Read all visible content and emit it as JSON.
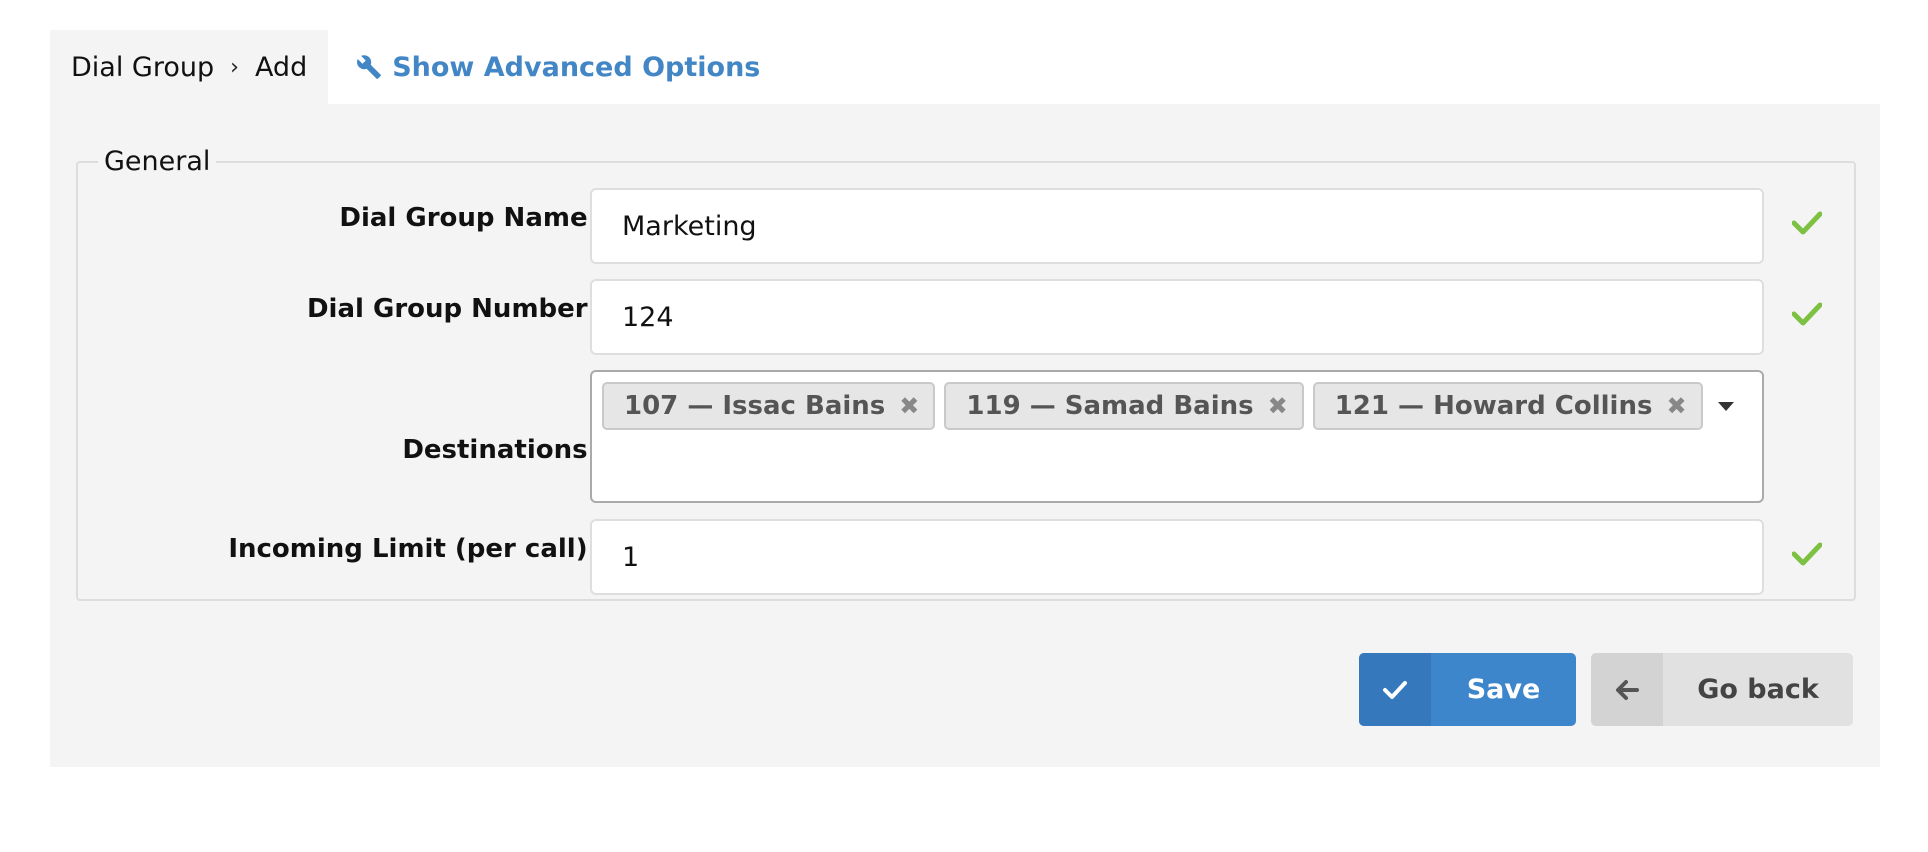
{
  "breadcrumb": {
    "section": "Dial Group",
    "current": "Add"
  },
  "advanced_link": {
    "label": "Show Advanced Options",
    "icon": "wrench-icon"
  },
  "fieldset": {
    "legend": "General"
  },
  "form": {
    "name": {
      "label": "Dial Group Name:",
      "value": "Marketing",
      "valid": true
    },
    "number": {
      "label": "Dial Group Number:",
      "value": "124",
      "valid": true
    },
    "destinations": {
      "label": "Destinations:",
      "selected": [
        {
          "text": "107  —  Issac Bains",
          "remove": "✖"
        },
        {
          "text": "119  —  Samad Bains",
          "remove": "✖"
        },
        {
          "text": "121  —  Howard Collins",
          "remove": "✖"
        }
      ]
    },
    "incoming_limit": {
      "label": "Incoming Limit (per call):",
      "value": "1",
      "valid": true
    }
  },
  "actions": {
    "save": {
      "label": "Save",
      "icon": "check-icon"
    },
    "back": {
      "label": "Go back",
      "icon": "arrow-left-icon"
    }
  },
  "colors": {
    "accent": "#3e86cc",
    "link": "#4386c6",
    "valid": "#7dc142",
    "panel": "#f4f4f4"
  }
}
